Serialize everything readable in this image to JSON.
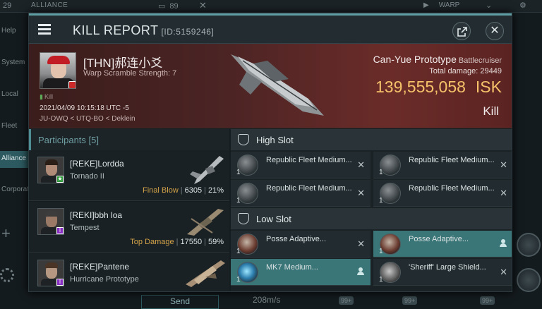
{
  "background": {
    "top_number": "29",
    "alliance_label": "ALLIANCE",
    "count": "89",
    "warp_label": "WARP",
    "sidebar_items": [
      "Help",
      "System",
      "Local",
      "Fleet",
      "Alliance",
      "Corporation"
    ],
    "send_label": "Send",
    "speed": "208m/s",
    "badge_99": "99+"
  },
  "header": {
    "title": "KILL REPORT",
    "id_text": "[ID:5159246]"
  },
  "victim": {
    "name": "[THN]郝连小爻",
    "scramble": "Warp Scramble Strength: 7",
    "kill_tag": "Kill",
    "datetime": "2021/04/09 10:15:18 UTC -5",
    "location": "JU-OWQ < UTQ-BO < Deklein",
    "ship": "Can-Yue Prototype",
    "ship_class": "Battlecruiser",
    "total_damage_label": "Total damage:",
    "total_damage": "29449",
    "isk_value": "139,555,058",
    "isk_unit": "ISK",
    "status": "Kill"
  },
  "participants": {
    "header": "Participants [5]",
    "rows": [
      {
        "name": "[REKE]Lordda",
        "ship": "Tornado II",
        "label": "Final Blow",
        "damage": "6305",
        "percent": "21%",
        "badge": "★",
        "badge_color": "#2f9b3b"
      },
      {
        "name": "[REKI]bbh loa",
        "ship": "Tempest",
        "label": "Top Damage",
        "damage": "17550",
        "percent": "59%",
        "badge": "I",
        "badge_color": "#8a2fc4"
      },
      {
        "name": "[REKE]Pantene",
        "ship": "Hurricane Prototype",
        "label": "",
        "damage": "",
        "percent": "",
        "badge": "I",
        "badge_color": "#8a2fc4"
      }
    ]
  },
  "fitting": {
    "high_slot": "High Slot",
    "low_slot": "Low Slot",
    "high_modules": [
      {
        "name": "Republic Fleet Medium...",
        "qty": "1"
      },
      {
        "name": "Republic Fleet Medium...",
        "qty": "1"
      },
      {
        "name": "Republic Fleet Medium...",
        "qty": "1"
      },
      {
        "name": "Republic Fleet Medium...",
        "qty": "1"
      }
    ],
    "low_modules": [
      {
        "name": "Posse Adaptive...",
        "qty": "1"
      },
      {
        "name": "Posse Adaptive...",
        "qty": "1"
      },
      {
        "name": "MK7 Medium...",
        "qty": "1"
      },
      {
        "name": "'Sheriff' Large Shield...",
        "qty": "1"
      }
    ]
  }
}
